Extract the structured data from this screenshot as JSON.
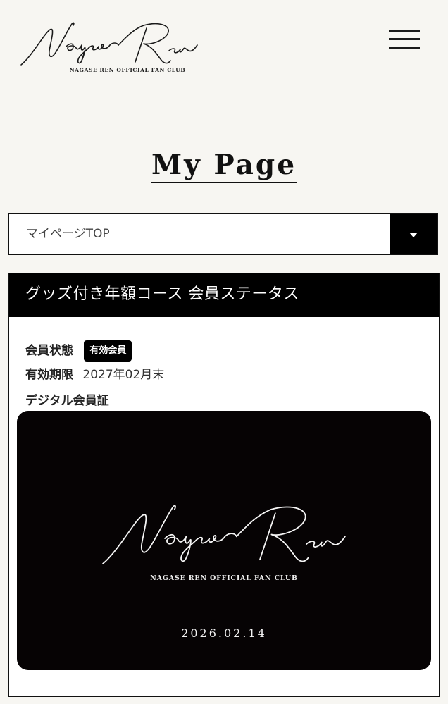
{
  "header": {
    "logo_subtitle": "NAGASE REN OFFICIAL FAN CLUB"
  },
  "page": {
    "title": "My Page"
  },
  "nav_select": {
    "selected": "マイページTOP"
  },
  "status_panel": {
    "title": "グッズ付き年額コース 会員ステータス",
    "membership_status_label": "会員状態",
    "membership_status_badge": "有効会員",
    "expiry_label": "有効期限",
    "expiry_value": "2027年02月末",
    "digital_card_label": "デジタル会員証"
  },
  "member_card": {
    "logo_subtitle": "NAGASE REN OFFICIAL FAN CLUB",
    "date": "2026.02.14"
  },
  "icons": {
    "menu": "hamburger-menu-icon",
    "dropdown": "caret-down-icon"
  },
  "colors": {
    "background": "#f7f6f2",
    "ink": "#111111",
    "panel_header": "#000000",
    "card": "#060304"
  }
}
